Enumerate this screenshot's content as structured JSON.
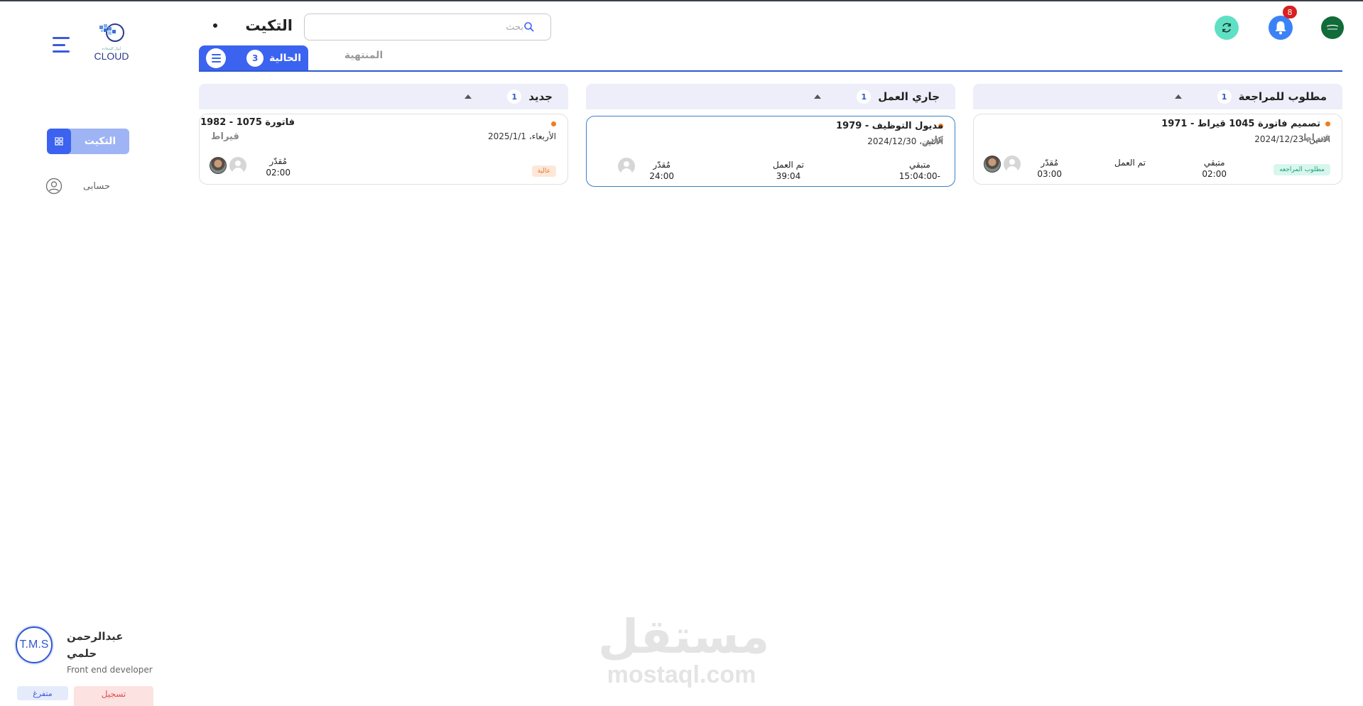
{
  "app": {
    "logo_text": "CLOUD",
    "logo_sub": "أنوار السعادة"
  },
  "sidebar": {
    "active_item": "التكيت",
    "items": [
      {
        "label": "حسابى"
      }
    ]
  },
  "user": {
    "initials": "T.M.S",
    "name": "عبدالرحمن حلمي",
    "role": "Front end developer",
    "status_label": "متفرغ",
    "action_label": "تسجيل"
  },
  "header": {
    "title": "التكيت",
    "search_placeholder": "بحث",
    "notifications_count": "8"
  },
  "tabs": [
    {
      "label": "الحالية",
      "count": "3",
      "active": true
    },
    {
      "label": "المنتهية",
      "active": false
    }
  ],
  "columns": [
    {
      "name": "مطلوب للمراجعة",
      "count": "1",
      "cards": [
        {
          "title": "تصميم فاتورة 1045 قيراط - 1971",
          "date": "الاثنين، 2024/12/23",
          "project": "قيراط",
          "remaining_label": "متبقي",
          "remaining": "02:00",
          "worked_label": "تم العمل",
          "worked": "",
          "estimated_label": "مُقدّر",
          "estimated": "03:00",
          "badge": "مطلوب المراجعه"
        }
      ]
    },
    {
      "name": "جاري العمل",
      "count": "1",
      "cards": [
        {
          "title": "مديول التوظيف - 1979",
          "date": "الاثنين، 2024/12/30",
          "project": "كادر",
          "remaining_label": "متبقي",
          "remaining": "-15:04:00",
          "worked_label": "تم العمل",
          "worked": "39:04",
          "estimated_label": "مُقدّر",
          "estimated": "24:00"
        }
      ]
    },
    {
      "name": "جديد",
      "count": "1",
      "cards": [
        {
          "title": "فاتورة 1075 - 1982",
          "date": "الأربعاء، 2025/1/1",
          "project": "قيراط",
          "estimated_label": "مُقدّر",
          "estimated": "02:00",
          "badge": "عالية"
        }
      ]
    }
  ],
  "watermark": {
    "ar": "مستقل",
    "en": "mostaql.com"
  },
  "colors": {
    "primary": "#3b63f0",
    "accent_orange": "#f07c1e",
    "refresh": "#5fe0c4",
    "badge_red": "#d91f1f"
  }
}
